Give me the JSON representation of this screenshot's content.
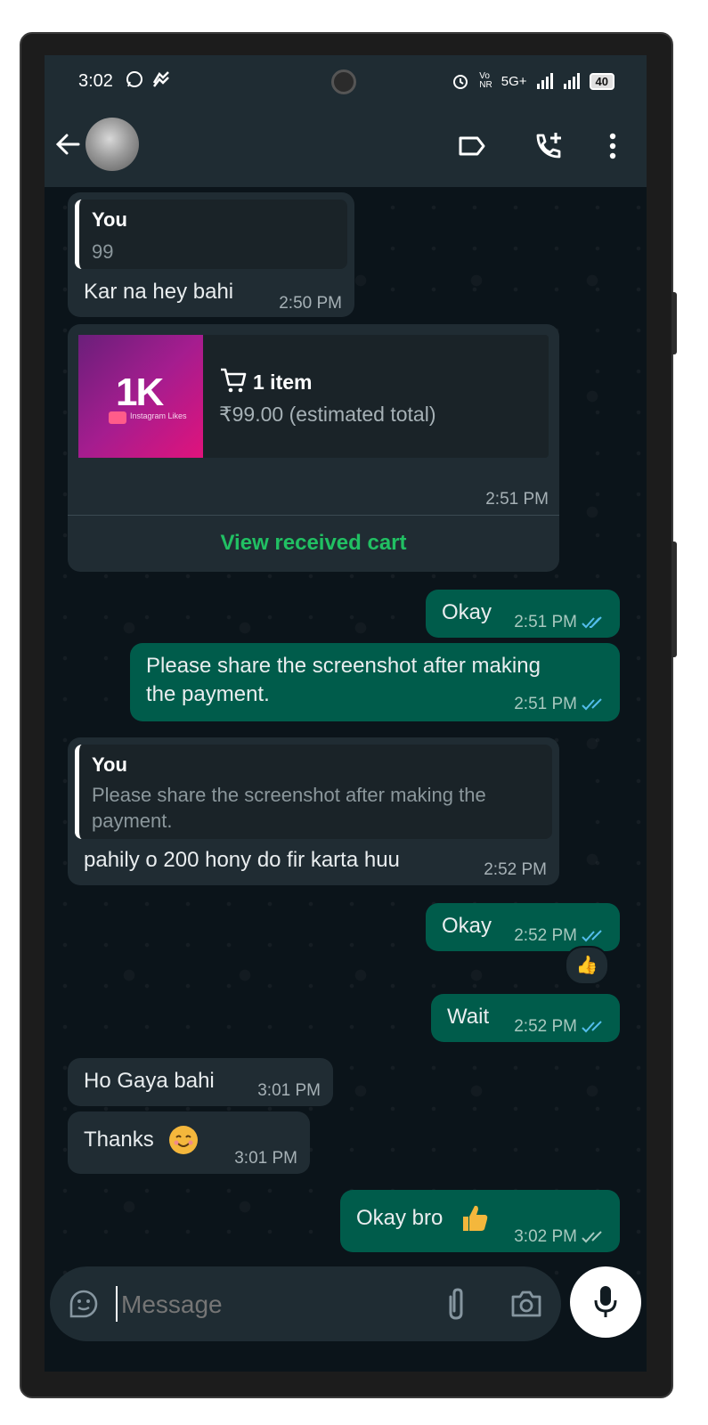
{
  "status_bar": {
    "time": "3:02",
    "network": "5G+",
    "battery": "40"
  },
  "header": {
    "contact_avatar": "avatar"
  },
  "messages": [
    {
      "dir": "in",
      "quote_name": "You",
      "quote_text": "99",
      "text": "Kar na hey bahi",
      "time": "2:50 PM"
    },
    {
      "dir": "in",
      "type": "cart",
      "thumb_text": "1K",
      "thumb_sub": "Instagram Likes",
      "items": "1 item",
      "total": "₹99.00 (estimated total)",
      "time": "2:51 PM",
      "action": "View received cart"
    },
    {
      "dir": "out",
      "text": "Okay",
      "time": "2:51 PM"
    },
    {
      "dir": "out",
      "text_line1": "Please share the screenshot after making",
      "text_line2": "the payment.",
      "time": "2:51 PM"
    },
    {
      "dir": "in",
      "quote_name": "You",
      "quote_line1": "Please share the screenshot after making the",
      "quote_line2": "payment.",
      "text": "pahily o 200 hony do fir karta huu",
      "time": "2:52 PM"
    },
    {
      "dir": "out",
      "text": "Okay",
      "time": "2:52 PM",
      "reaction": "👍"
    },
    {
      "dir": "out",
      "text": "Wait",
      "time": "2:52 PM"
    },
    {
      "dir": "in",
      "text": "Ho Gaya bahi",
      "time": "3:01 PM"
    },
    {
      "dir": "in",
      "text": "Thanks",
      "time": "3:01 PM"
    },
    {
      "dir": "out",
      "text": "Okay bro",
      "time": "3:02 PM"
    }
  ],
  "composer": {
    "placeholder": "Message"
  },
  "colors": {
    "incoming": "#202c33",
    "outgoing": "#005c4b",
    "accent": "#21c063",
    "read_ticks": "#53bdeb"
  }
}
